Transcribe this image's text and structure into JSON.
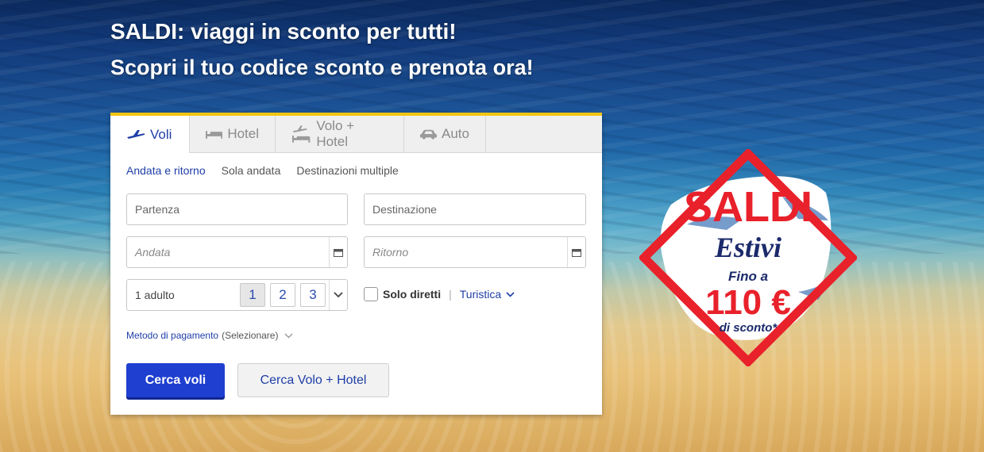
{
  "hero": {
    "headline": "SALDI: viaggi in sconto per tutti!",
    "subheadline": "Scopri il tuo codice sconto e prenota ora!"
  },
  "tabs": [
    {
      "label": "Voli",
      "icon": "plane-icon",
      "active": true
    },
    {
      "label": "Hotel",
      "icon": "bed-icon",
      "active": false
    },
    {
      "label": "Volo + Hotel",
      "icon": "plane-bed-icon",
      "active": false
    },
    {
      "label": "Auto",
      "icon": "car-icon",
      "active": false
    }
  ],
  "trip_types": [
    "Andata e ritorno",
    "Sola andata",
    "Destinazioni multiple"
  ],
  "form": {
    "departure_placeholder": "Partenza",
    "destination_placeholder": "Destinazione",
    "outbound_placeholder": "Andata",
    "return_placeholder": "Ritorno",
    "passengers_value": "1 adulto",
    "passenger_options": [
      "1",
      "2",
      "3"
    ],
    "direct_only_label": "Solo diretti",
    "separator": "|",
    "cabin_class": "Turistica",
    "payment_label": "Metodo di pagamento",
    "payment_value": "(Selezionare)"
  },
  "buttons": {
    "search_flights": "Cerca voli",
    "search_flight_hotel": "Cerca Volo + Hotel"
  },
  "promo": {
    "line1": "SALDI",
    "line2": "Estivi",
    "line3": "Fino a",
    "amount": "110 €",
    "line4": "di sconto*"
  },
  "colors": {
    "accent": "#1e3fcf",
    "tab_top_border": "#f2c414",
    "promo_red": "#e8212b",
    "promo_navy": "#1b2a6b"
  }
}
